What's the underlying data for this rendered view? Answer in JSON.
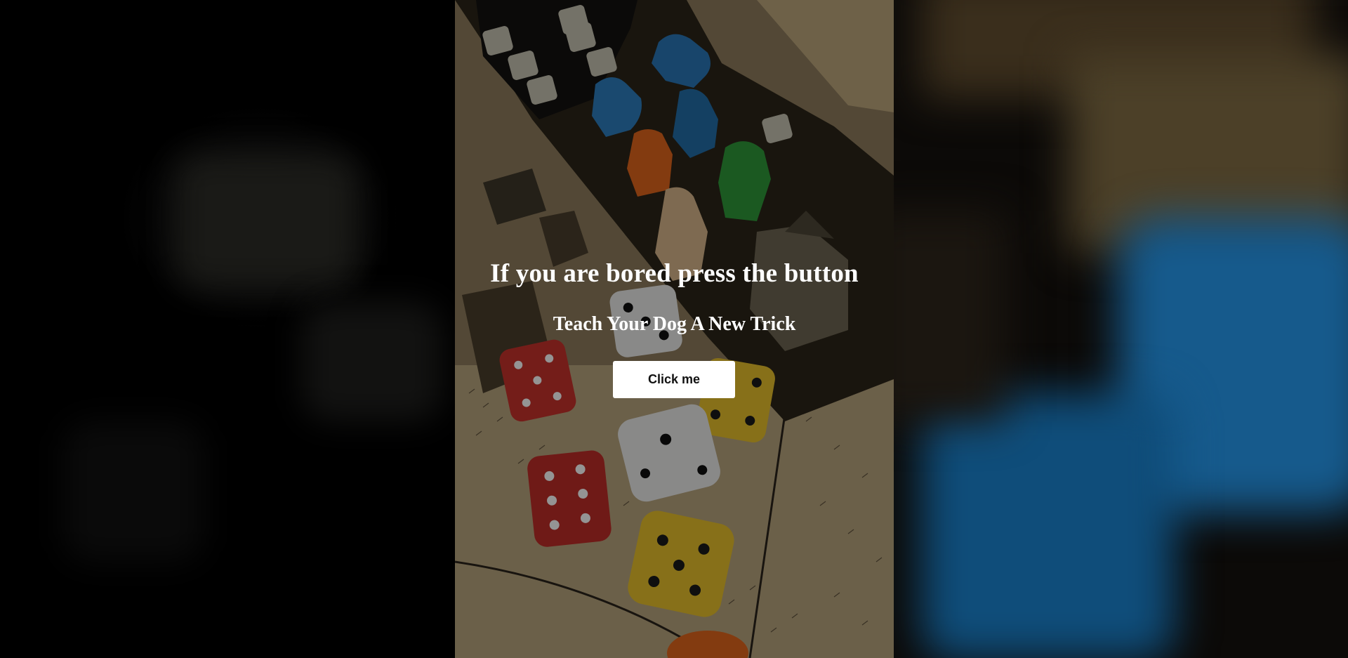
{
  "hero": {
    "title": "If you are bored press the button",
    "subtitle": "Teach Your Dog A New Trick",
    "button_label": "Click me"
  },
  "colors": {
    "background": "#000000",
    "text": "#ffffff",
    "button_bg": "#ffffff",
    "button_text": "#111111",
    "dice_red": "#c8322b",
    "dice_yellow": "#e9c22c",
    "dice_white": "#ececea",
    "meeple_blue": "#2a77b8",
    "meeple_orange": "#e2671c",
    "meeple_green": "#2f9a3a",
    "meeple_wood": "#d9b78c"
  },
  "background_image": "board-game-dice-and-meeples-photo"
}
